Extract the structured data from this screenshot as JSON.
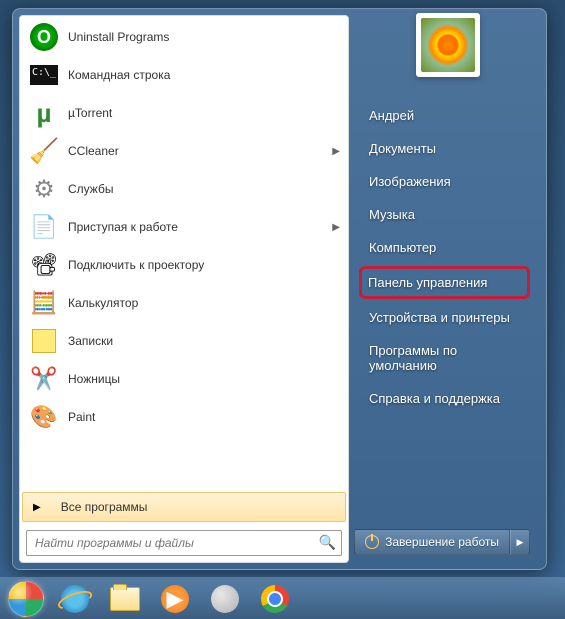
{
  "programs": [
    {
      "label": "Uninstall Programs",
      "icon": "uninstall",
      "arrow": false
    },
    {
      "label": "Командная строка",
      "icon": "cmd",
      "arrow": false
    },
    {
      "label": "µTorrent",
      "icon": "utorrent",
      "arrow": false
    },
    {
      "label": "CCleaner",
      "icon": "ccleaner",
      "arrow": true
    },
    {
      "label": "Службы",
      "icon": "services",
      "arrow": false
    },
    {
      "label": "Приступая к работе",
      "icon": "getting",
      "arrow": true
    },
    {
      "label": "Подключить к проектору",
      "icon": "projector",
      "arrow": false
    },
    {
      "label": "Калькулятор",
      "icon": "calc",
      "arrow": false
    },
    {
      "label": "Записки",
      "icon": "notes",
      "arrow": false
    },
    {
      "label": "Ножницы",
      "icon": "snip",
      "arrow": false
    },
    {
      "label": "Paint",
      "icon": "paint",
      "arrow": false
    }
  ],
  "all_programs": "Все программы",
  "search_placeholder": "Найти программы и файлы",
  "right_items": [
    {
      "label": "Андрей",
      "highlight": false
    },
    {
      "label": "Документы",
      "highlight": false
    },
    {
      "label": "Изображения",
      "highlight": false
    },
    {
      "label": "Музыка",
      "highlight": false
    },
    {
      "label": "Компьютер",
      "highlight": false
    },
    {
      "label": "Панель управления",
      "highlight": true
    },
    {
      "label": "Устройства и принтеры",
      "highlight": false
    },
    {
      "label": "Программы по умолчанию",
      "highlight": false
    },
    {
      "label": "Справка и поддержка",
      "highlight": false
    }
  ],
  "shutdown_label": "Завершение работы",
  "taskbar": [
    "ie",
    "explorer",
    "wmp",
    "blank",
    "chrome"
  ]
}
